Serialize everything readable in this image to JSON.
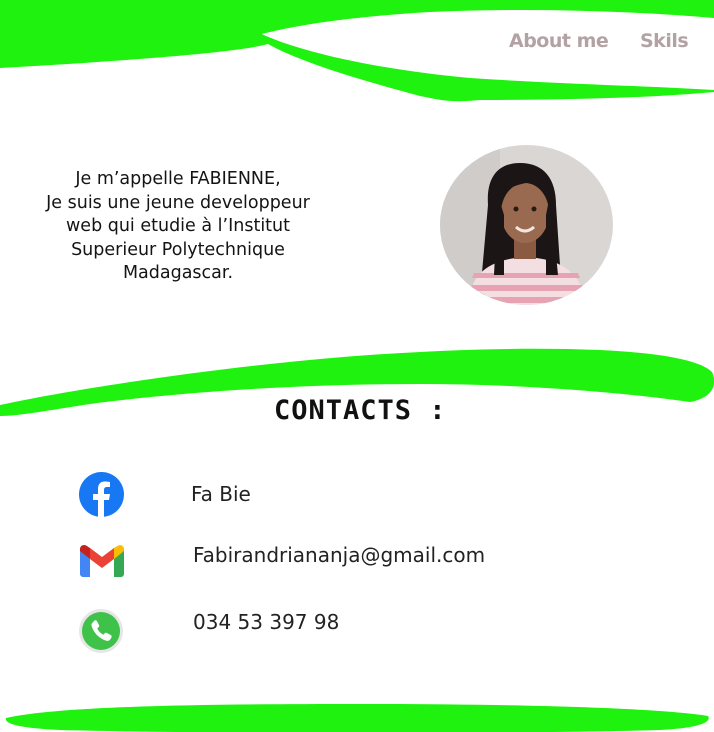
{
  "nav": {
    "about_label": "About me",
    "skills_label": "Skils"
  },
  "intro": {
    "lines": [
      "Je m’appelle FABIENNE,",
      "Je suis une jeune developpeur",
      "web qui etudie à l’Institut",
      "Superieur Polytechnique",
      "Madagascar."
    ]
  },
  "contacts": {
    "title": "CONTACTS :",
    "facebook": "Fa Bie",
    "email": "Fabirandriananja@gmail.com",
    "phone": "034 53 397 98"
  },
  "icons": {
    "facebook": "facebook-icon",
    "gmail": "gmail-icon",
    "phone": "phone-icon"
  },
  "colors": {
    "accent_green": "#1ff20f",
    "nav_text": "#b3a2a4",
    "facebook_blue": "#1877f2",
    "whatsapp_green": "#3fc24a"
  }
}
